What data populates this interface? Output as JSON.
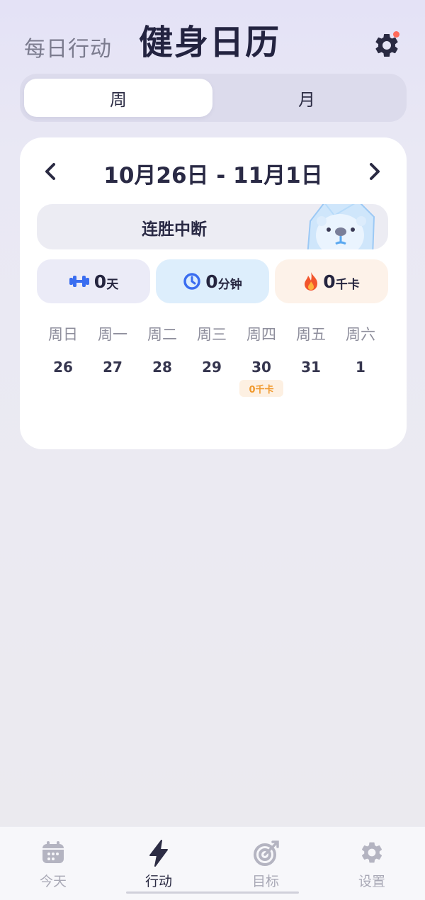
{
  "header": {
    "subtitle": "每日行动",
    "title": "健身日历",
    "settings_icon": "gear-icon"
  },
  "segment": {
    "week_label": "周",
    "month_label": "月",
    "selected": "周"
  },
  "calendar": {
    "date_range": "10月26日 - 11月1日",
    "streak_label": "连胜中断",
    "stats": {
      "days_value": "0",
      "days_unit": "天",
      "minutes_value": "0",
      "minutes_unit": "分钟",
      "kcal_value": "0",
      "kcal_unit": "千卡"
    },
    "weekdays": [
      "周日",
      "周一",
      "周二",
      "周三",
      "周四",
      "周五",
      "周六"
    ],
    "dates": [
      "26",
      "27",
      "28",
      "29",
      "30",
      "31",
      "1"
    ],
    "kcal_tag": "0千卡"
  },
  "tabbar": {
    "tabs": [
      {
        "label": "今天",
        "icon": "calendar-icon"
      },
      {
        "label": "行动",
        "icon": "lightning-icon",
        "active": true
      },
      {
        "label": "目标",
        "icon": "target-icon"
      },
      {
        "label": "设置",
        "icon": "gear-icon"
      }
    ]
  },
  "colors": {
    "accent_dark": "#232340",
    "kcal_orange": "#f0982b",
    "notify_dot": "#ff6a5a",
    "icon_blue": "#3a6df0"
  }
}
